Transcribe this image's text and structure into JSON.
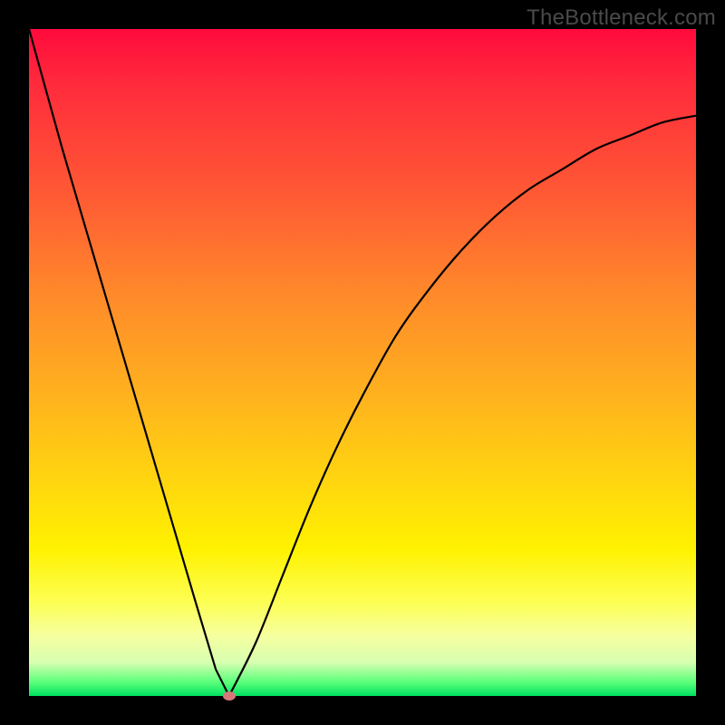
{
  "watermark": "TheBottleneck.com",
  "chart_data": {
    "type": "line",
    "title": "",
    "xlabel": "",
    "ylabel": "",
    "xlim": [
      0,
      100
    ],
    "ylim": [
      0,
      100
    ],
    "series": [
      {
        "name": "curve",
        "x": [
          0,
          5,
          10,
          15,
          20,
          25,
          28,
          30,
          34,
          38,
          42,
          46,
          50,
          55,
          60,
          65,
          70,
          75,
          80,
          85,
          90,
          95,
          100
        ],
        "values": [
          100,
          82,
          65,
          48,
          31,
          14,
          4,
          0,
          8,
          18,
          28,
          37,
          45,
          54,
          61,
          67,
          72,
          76,
          79,
          82,
          84,
          86,
          87
        ]
      }
    ],
    "marker": {
      "x": 30,
      "y": 0
    },
    "gradient_stops": [
      {
        "pos": 0,
        "color": "#ff0a3c"
      },
      {
        "pos": 25,
        "color": "#ff5a34"
      },
      {
        "pos": 55,
        "color": "#ffb21e"
      },
      {
        "pos": 78,
        "color": "#fff200"
      },
      {
        "pos": 100,
        "color": "#00e060"
      }
    ]
  }
}
